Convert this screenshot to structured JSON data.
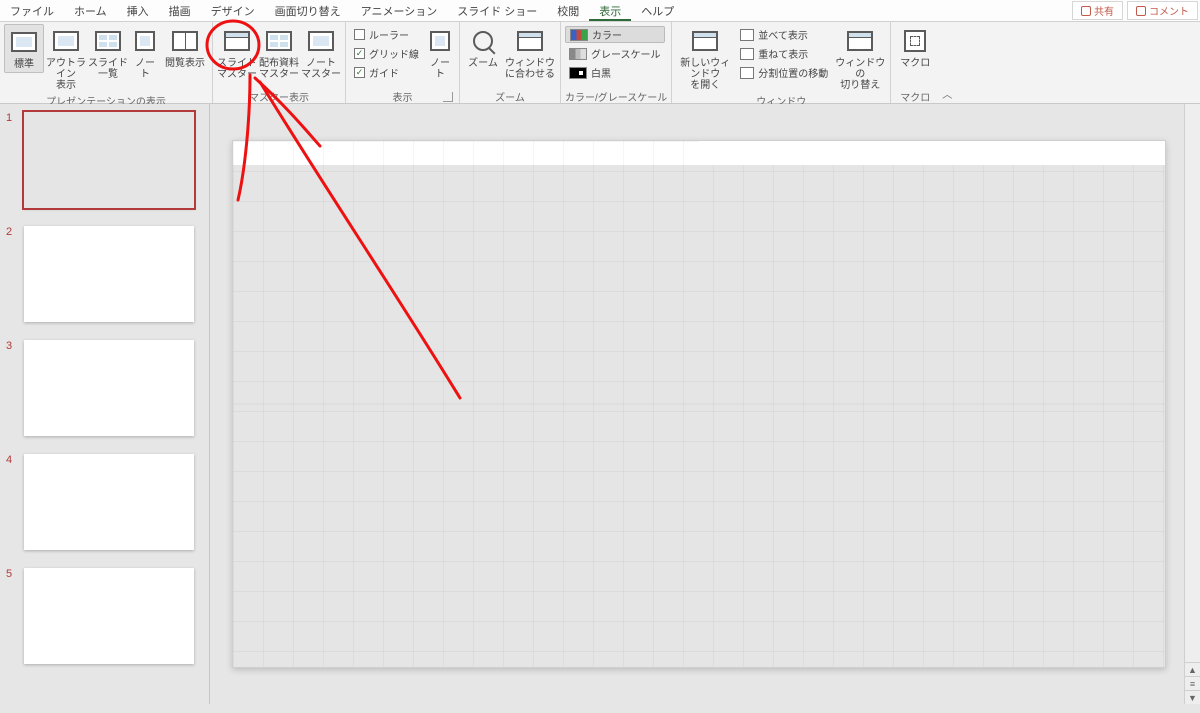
{
  "tabs": {
    "file": "ファイル",
    "home": "ホーム",
    "insert": "挿入",
    "draw": "描画",
    "design": "デザイン",
    "transitions": "画面切り替え",
    "animations": "アニメーション",
    "slideshow": "スライド ショー",
    "review": "校閲",
    "view": "表示",
    "help": "ヘルプ"
  },
  "titleButtons": {
    "share": "共有",
    "comments": "コメント"
  },
  "ribbon": {
    "presViews": {
      "normal": "標準",
      "outline": "アウトライン\n表示",
      "sorter": "スライド\n一覧",
      "notes": "ノー\nト",
      "reading": "閲覧表示",
      "label": "プレゼンテーションの表示"
    },
    "masterViews": {
      "slideMaster": "スライド\nマスター",
      "handoutMaster": "配布資料\nマスター",
      "notesMaster": "ノート\nマスター",
      "label": "マスター表示"
    },
    "show": {
      "ruler": "ルーラー",
      "gridlines": "グリッド線",
      "guides": "ガイド",
      "notesBtn": "ノー\nト",
      "label": "表示"
    },
    "zoom": {
      "zoom": "ズーム",
      "fit": "ウィンドウ\nに合わせる",
      "label": "ズーム"
    },
    "color": {
      "color": "カラー",
      "gray": "グレースケール",
      "bw": "白黒",
      "label": "カラー/グレースケール"
    },
    "window": {
      "newWindow": "新しいウィンドウ\nを開く",
      "arrange": "並べて表示",
      "cascade": "重ねて表示",
      "split": "分割位置の移動",
      "switch": "ウィンドウの\n切り替え",
      "label": "ウィンドウ"
    },
    "macro": {
      "macros": "マクロ",
      "label": "マクロ"
    }
  },
  "slides": {
    "numbers": [
      "1",
      "2",
      "3",
      "4",
      "5"
    ]
  }
}
